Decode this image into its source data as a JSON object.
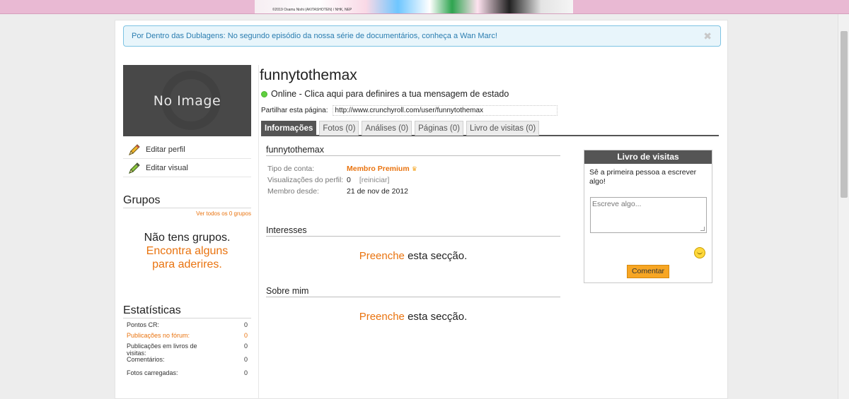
{
  "banner": {
    "credit": "©2019 Osamu Nishi (AKITASHOTEN) / NHK, NEP"
  },
  "notice": {
    "text": "Por Dentro das Dublagens: No segundo episódio da nossa série de documentários, conheça a Wan Marc!",
    "close_icon": "close-icon"
  },
  "avatar": {
    "text": "No Image"
  },
  "left": {
    "edit_profile": "Editar perfil",
    "edit_visual": "Editar visual",
    "groups_title": "Grupos",
    "see_all_groups": "Ver todos os 0 grupos",
    "no_groups_line1": "Não tens grupos.",
    "no_groups_link1": "Encontra alguns",
    "no_groups_link2": "para aderires.",
    "stats_title": "Estatísticas",
    "stats": [
      {
        "label": "Pontos CR:",
        "value": "0"
      },
      {
        "label": "Publicações no fórum:",
        "value": "0"
      },
      {
        "label": "Publicações em livros de visitas:",
        "value": "0"
      },
      {
        "label": "Comentários:",
        "value": "0"
      },
      {
        "label": "Fotos carregadas:",
        "value": "0"
      }
    ]
  },
  "profile": {
    "username": "funnytothemax",
    "status": "Online - Clica aqui para definires a tua mensagem de estado",
    "share_label": "Partilhar esta página:",
    "share_url": "http://www.crunchyroll.com/user/funnytothemax"
  },
  "tabs": [
    {
      "label": "Informações"
    },
    {
      "label": "Fotos (0)"
    },
    {
      "label": "Análises (0)"
    },
    {
      "label": "Páginas (0)"
    },
    {
      "label": "Livro de visitas (0)"
    }
  ],
  "info": {
    "title": "funnytothemax",
    "account_type_label": "Tipo de conta:",
    "account_type_value": "Membro Premium",
    "views_label": "Visualizações do perfil:",
    "views_value": "0",
    "views_reset": "[reiniciar]",
    "member_since_label": "Membro desde:",
    "member_since_value": "21 de nov de 2012",
    "interests_title": "Interesses",
    "about_title": "Sobre mim",
    "fill_link": "Preenche",
    "fill_text": " esta secção."
  },
  "guestbook": {
    "title": "Livro de visitas",
    "message": "Sê a primeira pessoa a escrever algo!",
    "placeholder": "Escreve algo...",
    "button": "Comentar"
  },
  "colors": {
    "accent": "#e9730f",
    "notice_text": "#2a7db0",
    "tab_active": "#555555",
    "online": "#5fcf3f"
  }
}
